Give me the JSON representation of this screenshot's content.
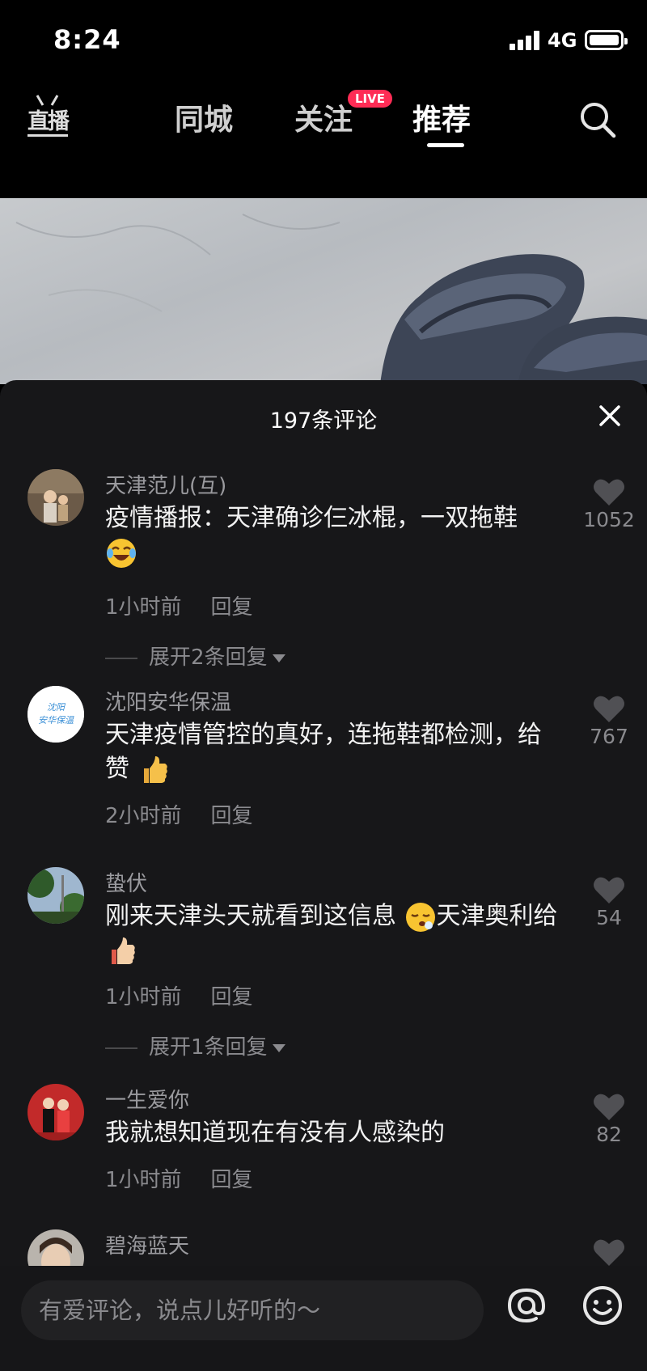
{
  "status_bar": {
    "time": "8:24",
    "network": "4G"
  },
  "nav": {
    "live_label": "直播",
    "tabs": [
      {
        "label": "同城"
      },
      {
        "label": "关注",
        "badge": "LIVE"
      },
      {
        "label": "推荐",
        "active": true
      }
    ],
    "colors": {
      "badge": "#fe2c55"
    }
  },
  "comments_panel": {
    "title": "197条评论",
    "comments": [
      {
        "username": "天津范儿(互)",
        "text": "疫情播报：天津确诊仨冰棍，一双拖鞋",
        "emoji": "laughing-crying",
        "time": "1小时前",
        "reply_label": "回复",
        "likes": "1052",
        "expand": "展开2条回复"
      },
      {
        "username": "沈阳安华保温",
        "avatar_text": [
          "沈阳",
          "安华保温"
        ],
        "text": "天津疫情管控的真好，连拖鞋都检测，给赞",
        "emoji": "thumbs-up",
        "time": "2小时前",
        "reply_label": "回复",
        "likes": "767"
      },
      {
        "username": "蛰伏",
        "text_a": "刚来天津头天就看到这信息",
        "text_b": "天津奥利给",
        "emoji_a": "sleepy-face",
        "emoji_b": "thumbs-up",
        "time": "1小时前",
        "reply_label": "回复",
        "likes": "54",
        "expand": "展开1条回复"
      },
      {
        "username": "一生爱你",
        "text": "我就想知道现在有没有人感染的",
        "time": "1小时前",
        "reply_label": "回复",
        "likes": "82"
      },
      {
        "username": "碧海蓝天"
      }
    ]
  },
  "bottom_bar": {
    "placeholder": "有爱评论，说点儿好听的～",
    "icons": [
      "at-icon",
      "emoji-icon"
    ]
  }
}
